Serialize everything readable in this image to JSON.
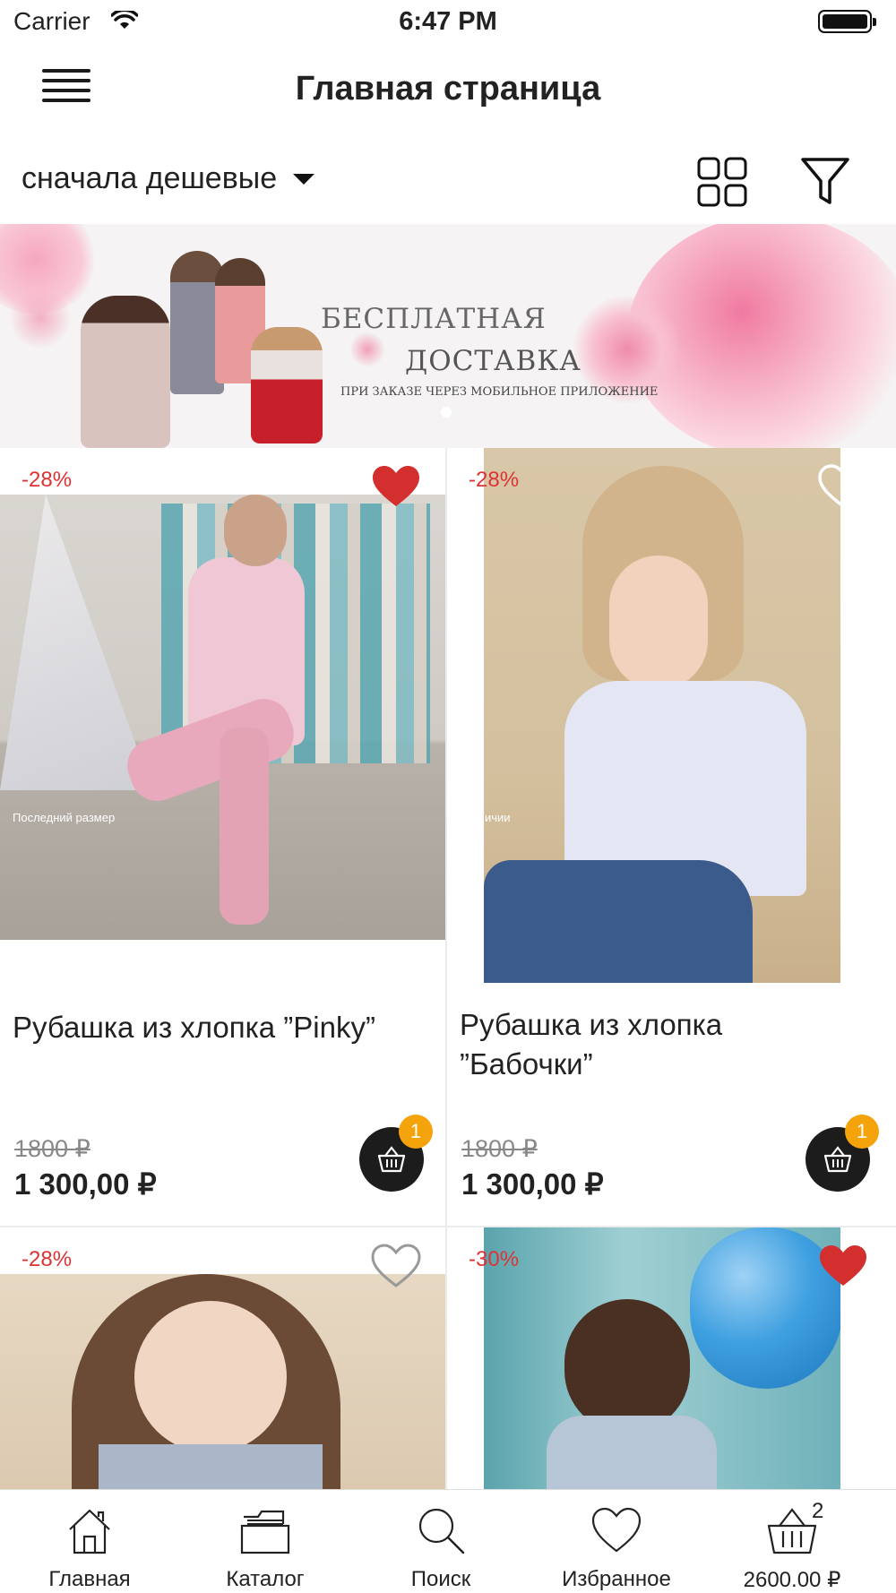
{
  "status_bar": {
    "carrier": "Carrier",
    "time": "6:47 PM"
  },
  "nav": {
    "title": "Главная страница"
  },
  "sort": {
    "selected": "сначала дешевые"
  },
  "banner": {
    "line1": "БЕСПЛАТНАЯ",
    "line2": "ДОСТАВКА",
    "line3": "ПРИ ЗАКАЗЕ ЧЕРЕЗ МОБИЛЬНОЕ ПРИЛОЖЕНИЕ"
  },
  "products": [
    {
      "discount": "-28%",
      "favorite": true,
      "name": "Рубашка из хлопка ”Pinky”",
      "old_price": "1800 ₽",
      "price": "1 300,00 ₽",
      "cart_count": "1",
      "caption": "Последний размер"
    },
    {
      "discount": "-28%",
      "favorite": false,
      "name": "Рубашка из хлопка ”Бабочки”",
      "old_price": "1800 ₽",
      "price": "1 300,00 ₽",
      "cart_count": "1",
      "caption": "ичии"
    },
    {
      "discount": "-28%",
      "favorite": false
    },
    {
      "discount": "-30%",
      "favorite": true
    }
  ],
  "tabs": [
    {
      "label": "Главная",
      "icon": "home-icon"
    },
    {
      "label": "Каталог",
      "icon": "catalog-icon"
    },
    {
      "label": "Поиск",
      "icon": "search-icon"
    },
    {
      "label": "Избранное",
      "icon": "heart-icon"
    },
    {
      "label": "2600.00 ₽",
      "icon": "basket-icon",
      "badge": "2"
    }
  ],
  "colors": {
    "accent_red": "#d32f2f",
    "badge_orange": "#f5a30b",
    "dark": "#1c1c1c"
  }
}
